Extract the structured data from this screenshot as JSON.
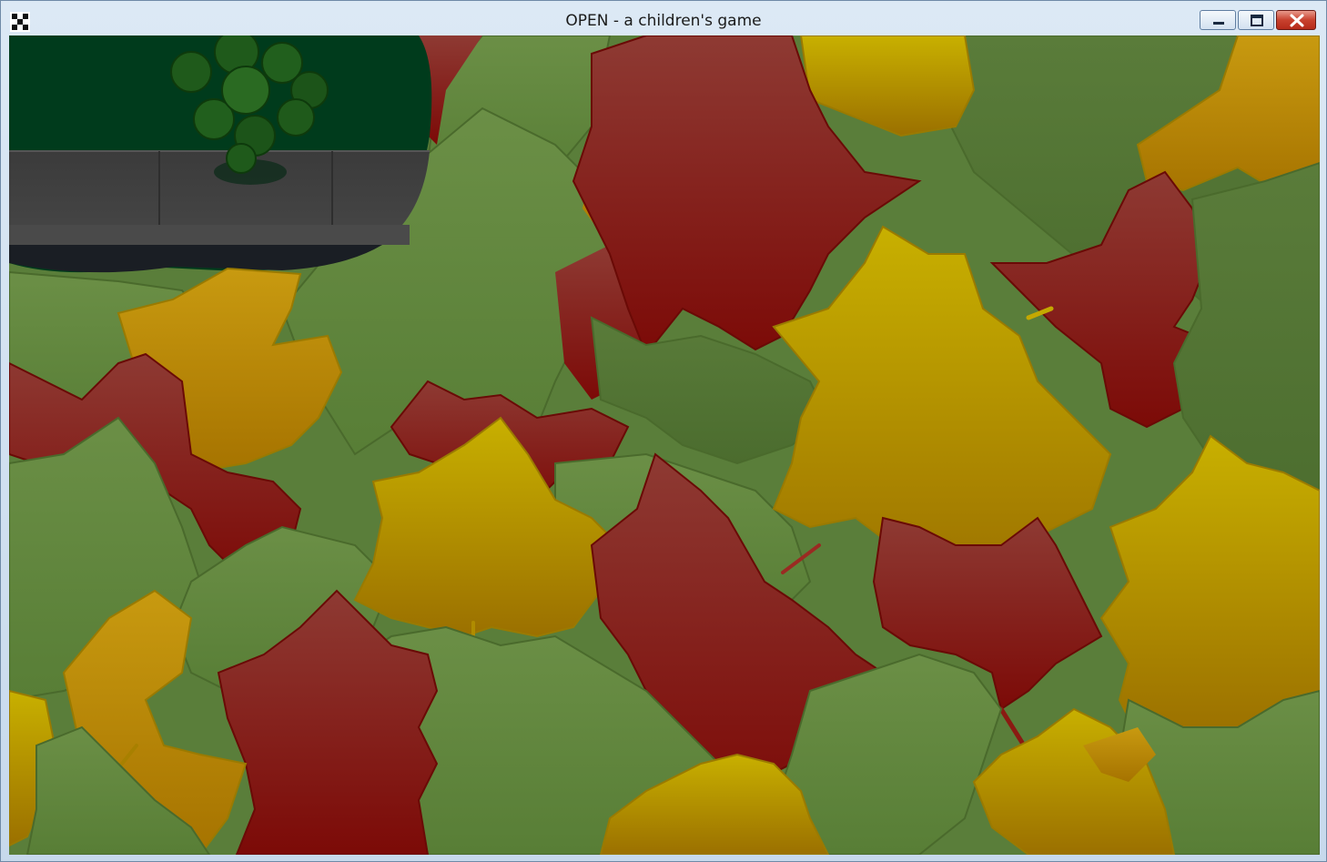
{
  "window": {
    "title": "OPEN - a children's game",
    "app_icon": "checkered-app-icon",
    "controls": [
      "minimize-icon",
      "maximize-icon",
      "close-icon"
    ]
  },
  "scene": {
    "description_icon": "autumn-leaf-pile",
    "colors": {
      "green": "#5f8a3e",
      "dark_green": "#4d6f30",
      "red": "#8d1c16",
      "yellow": "#c9a80c",
      "orange": "#b8860b",
      "background_grass": "#003f1e",
      "path": "#3e3e3e"
    }
  }
}
